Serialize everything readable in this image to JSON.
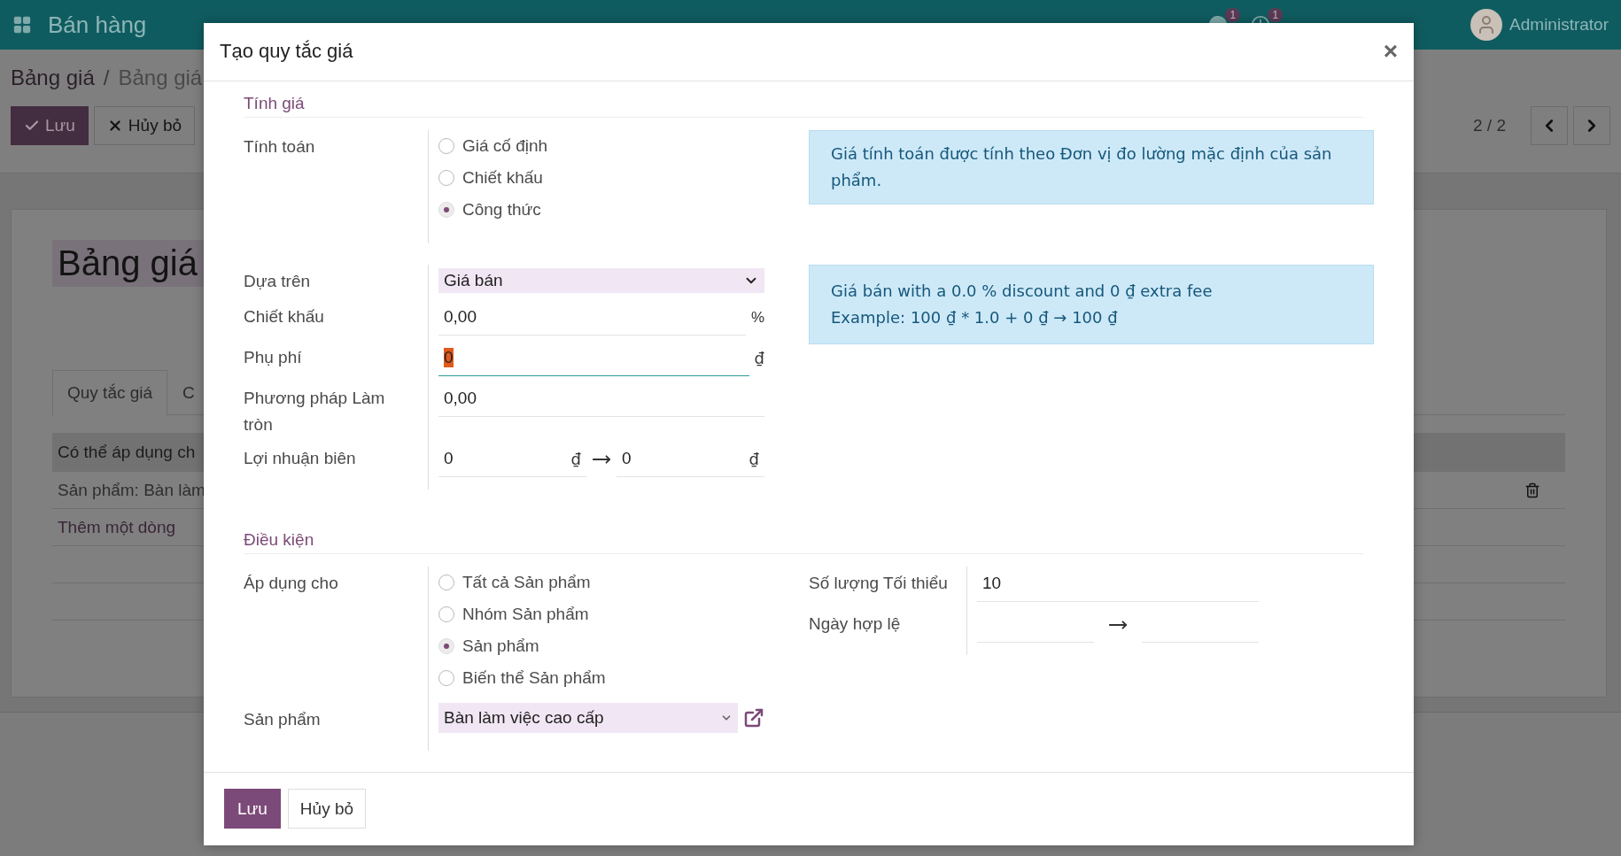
{
  "topbar": {
    "app_title": "Bán hàng",
    "notifications": [
      {
        "kind": "chat",
        "count": "1"
      },
      {
        "kind": "activity",
        "count": "1"
      }
    ],
    "user": "Administrator"
  },
  "background": {
    "breadcrumb": [
      "Bảng giá",
      "Bảng giá"
    ],
    "separator": "/",
    "buttons": [
      {
        "label": "Lưu",
        "kind": "primary"
      },
      {
        "label": "Hủy bỏ",
        "kind": "secondary"
      }
    ],
    "pager": "2 / 2",
    "title": "Bảng giá",
    "tabs": [
      {
        "label": "Quy tắc giá",
        "selected": true
      },
      {
        "label": "C",
        "selected": false
      }
    ],
    "table": {
      "columns": [
        "Có thể áp dụng ch"
      ],
      "rows": [
        "Sản phẩm: Bàn làm"
      ],
      "add_line": "Thêm một dòng"
    }
  },
  "dialog": {
    "title": "Tạo quy tắc giá",
    "close": "×",
    "pricing": {
      "heading": "Tính giá",
      "compute": {
        "label": "Tính toán",
        "options": [
          {
            "label": "Giá cố định",
            "selected": false
          },
          {
            "label": "Chiết khấu",
            "selected": false
          },
          {
            "label": "Công thức",
            "selected": true
          }
        ]
      },
      "note": "Giá tính toán được tính theo Đơn vị đo lường mặc định của sản phẩm.",
      "based_on": {
        "label": "Dựa trên",
        "value": "Giá bán"
      },
      "discount": {
        "label": "Chiết khấu",
        "value": "0,00",
        "unit": "%"
      },
      "surcharge": {
        "label": "Phụ phí",
        "value": "0",
        "unit": "₫",
        "focused": true
      },
      "rounding": {
        "label": "Phương pháp Làm tròn",
        "value": "0,00"
      },
      "margin": {
        "label": "Lợi nhuận biên",
        "min": "0",
        "max": "0",
        "unit": "₫"
      },
      "formula": [
        "Giá bán with a 0.0 % discount and 0 ₫ extra fee",
        "Example: 100 ₫ * 1.0 + 0 ₫ → 100 ₫"
      ]
    },
    "conditions": {
      "heading": "Điều kiện",
      "apply_on": {
        "label": "Áp dụng cho",
        "options": [
          {
            "label": "Tất cả Sản phẩm",
            "selected": false
          },
          {
            "label": "Nhóm Sản phẩm",
            "selected": false
          },
          {
            "label": "Sản phẩm",
            "selected": true
          },
          {
            "label": "Biến thể Sản phẩm",
            "selected": false
          }
        ]
      },
      "product": {
        "label": "Sản phẩm",
        "value": "Bàn làm việc cao cấp"
      },
      "min_qty": {
        "label": "Số lượng Tối thiểu",
        "value": "10"
      },
      "validity": {
        "label": "Ngày hợp lệ"
      }
    },
    "buttons": [
      {
        "label": "Lưu",
        "kind": "primary"
      },
      {
        "label": "Hủy bỏ",
        "kind": "secondary"
      }
    ]
  }
}
